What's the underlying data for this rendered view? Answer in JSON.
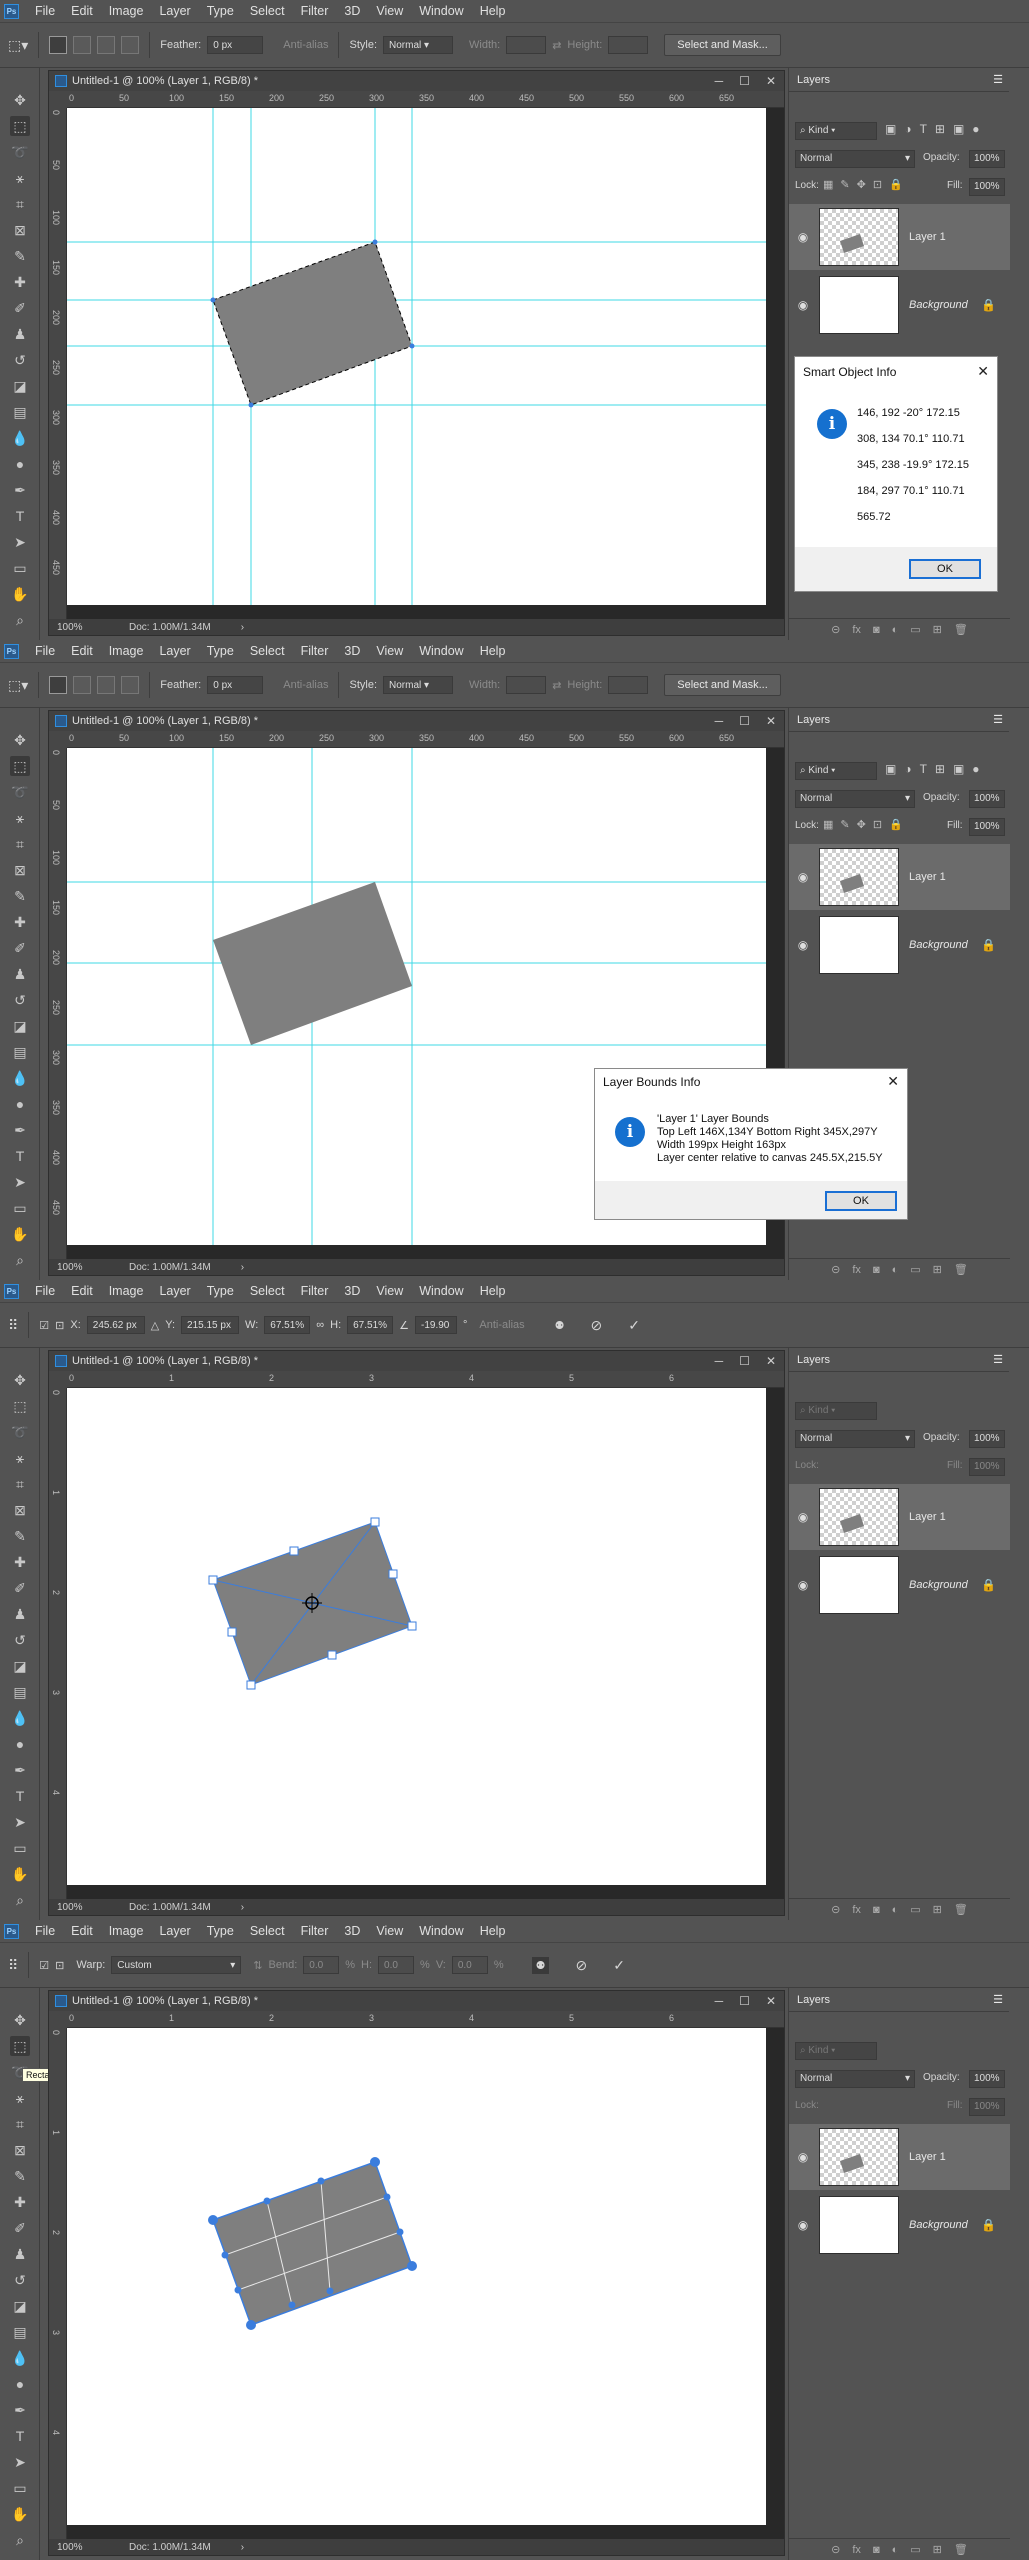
{
  "menu": [
    "File",
    "Edit",
    "Image",
    "Layer",
    "Type",
    "Select",
    "Filter",
    "3D",
    "View",
    "Window",
    "Help"
  ],
  "options_marquee": {
    "feather_label": "Feather:",
    "feather_value": "0 px",
    "antialias_label": "Anti-alias",
    "style_label": "Style:",
    "style_value": "Normal",
    "width_label": "Width:",
    "height_label": "Height:",
    "select_mask_label": "Select and Mask..."
  },
  "options_transform": {
    "x_label": "X:",
    "x_value": "245.62 px",
    "y_label": "Y:",
    "y_value": "215.15 px",
    "w_label": "W:",
    "w_value": "67.51%",
    "h_label": "H:",
    "h_value": "67.51%",
    "angle_value": "-19.90",
    "angle_unit": "°",
    "interp_label": "Anti-alias"
  },
  "options_warp": {
    "warp_label": "Warp:",
    "warp_value": "Custom",
    "bend_label": "Bend:",
    "bend_value": "0.0",
    "h_label": "H:",
    "h_value": "0.0",
    "v_label": "V:",
    "v_value": "0.0",
    "pct": "%"
  },
  "document": {
    "tab_title": "Untitled-1 @ 100% (Layer 1, RGB/8) *",
    "zoom": "100%",
    "doc_size": "Doc: 1.00M/1.34M",
    "ruler_px": [
      "0",
      "50",
      "100",
      "150",
      "200",
      "250",
      "300",
      "350",
      "400",
      "450",
      "500",
      "550",
      "600",
      "650"
    ],
    "ruler_px_v": [
      "0",
      "50",
      "100",
      "150",
      "200",
      "250",
      "300",
      "350",
      "400",
      "450"
    ],
    "ruler_in": [
      "0",
      "1",
      "2",
      "3",
      "4",
      "5",
      "6"
    ],
    "ruler_in_v": [
      "0",
      "1",
      "2",
      "3",
      "4"
    ]
  },
  "layers_panel": {
    "title": "Layers",
    "kind_label": "Kind",
    "blend_mode": "Normal",
    "opacity_label": "Opacity:",
    "opacity_value": "100%",
    "lock_label": "Lock:",
    "fill_label": "Fill:",
    "fill_value": "100%",
    "layers": [
      {
        "name": "Layer 1",
        "selected": true
      },
      {
        "name": "Background",
        "selected": false
      }
    ],
    "footer_icons": [
      "link-icon",
      "fx-icon",
      "mask-icon",
      "adjustment-icon",
      "group-icon",
      "new-layer-icon",
      "trash-icon"
    ]
  },
  "smart_object_dialog": {
    "title": "Smart Object Info",
    "lines": [
      "146, 192 -20° 172.15",
      "308, 134 70.1° 110.71",
      "345, 238 -19.9° 172.15",
      "184, 297 70.1° 110.71",
      "565.72"
    ],
    "ok": "OK"
  },
  "layer_bounds_dialog": {
    "title": "Layer Bounds Info",
    "lines": [
      "'Layer 1' Layer Bounds",
      "Top Left 146X,134Y   Bottom Right 345X,297Y",
      "Width 199px   Height 163px",
      "Layer center relative to canvas 245.5X,215.5Y"
    ],
    "ok": "OK"
  },
  "tooltip": "Rectangular Marquee Tool (M)",
  "colors": {
    "app_bg": "#535353",
    "guide": "#3fd9e6",
    "shape_fill": "#7f7f7f",
    "dialog_accent": "#1570cf",
    "warp_handle": "#3b7ddd"
  }
}
